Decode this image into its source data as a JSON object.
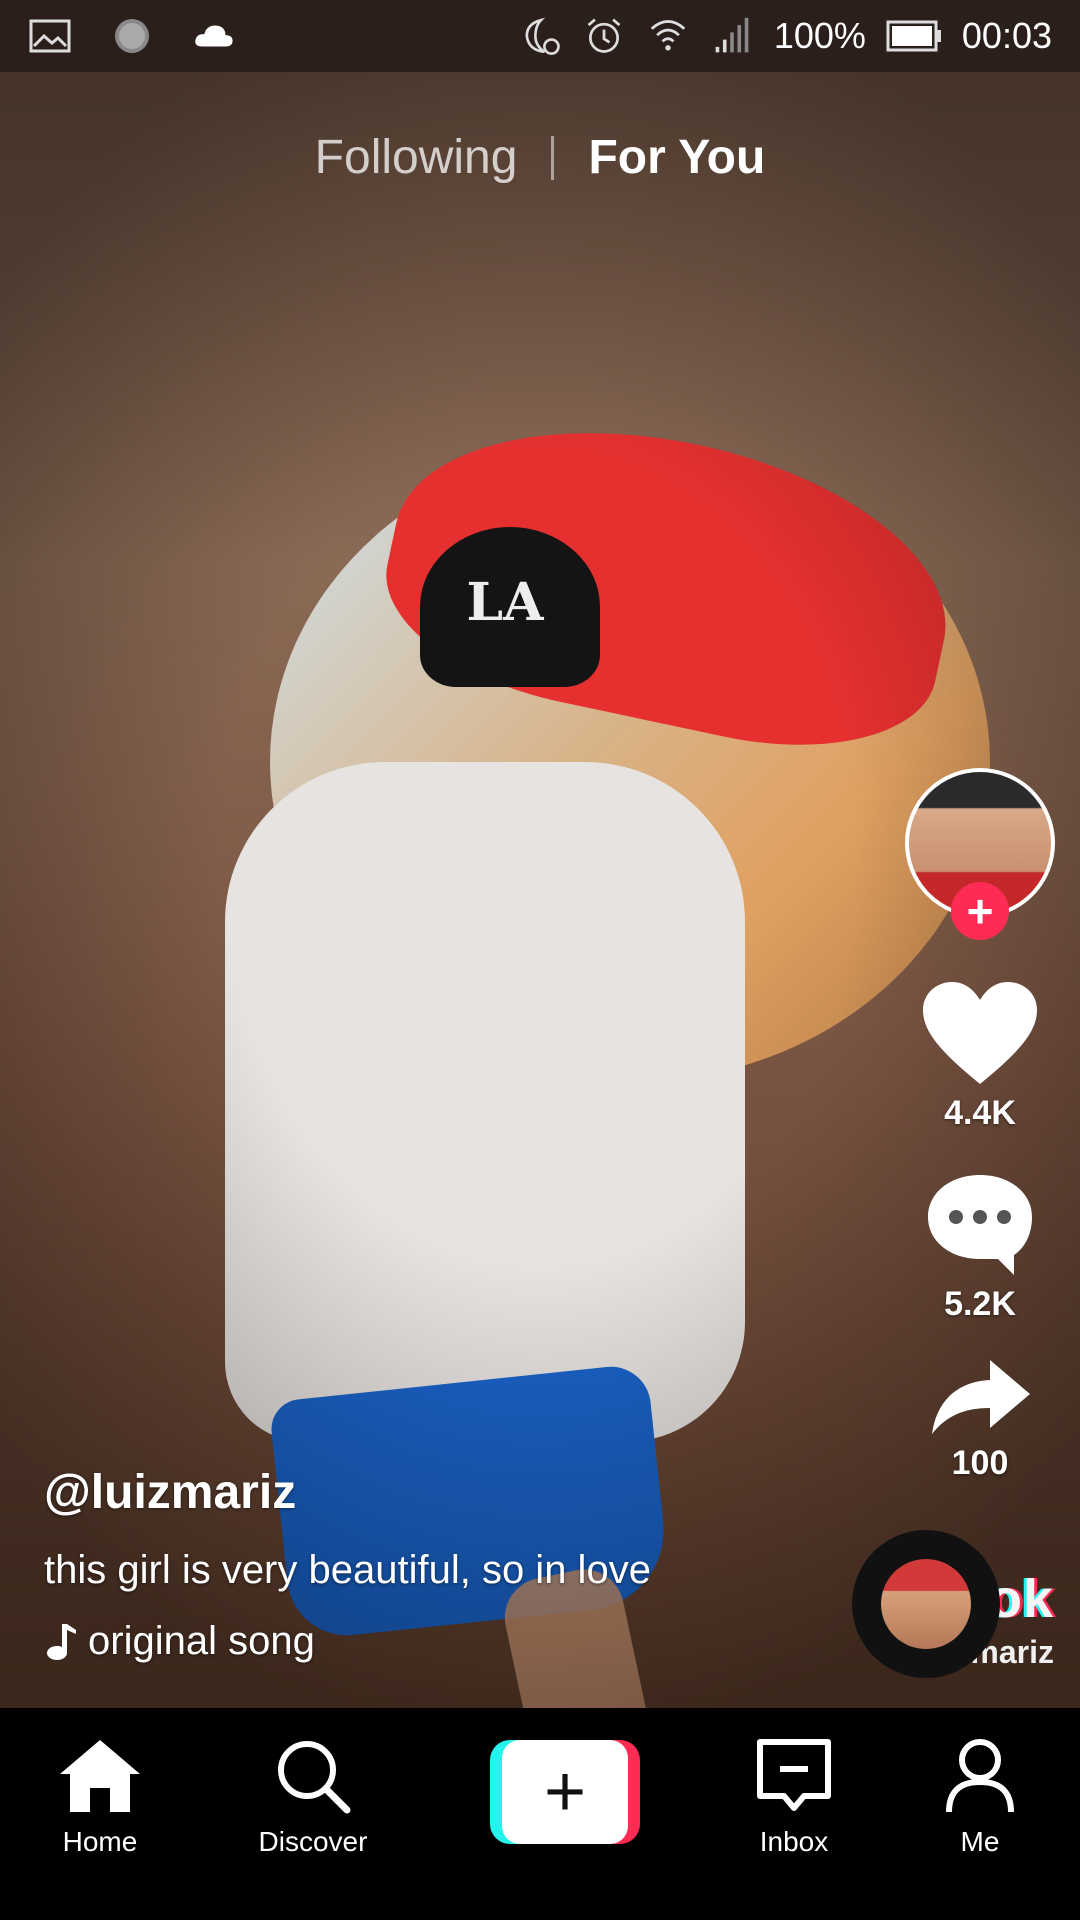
{
  "status_bar": {
    "battery_percent": "100%",
    "time": "00:03",
    "icons": [
      "gallery-icon",
      "loading-icon",
      "cloud-icon",
      "do-not-disturb-icon",
      "alarm-icon",
      "wifi-icon",
      "signal-icon",
      "battery-icon"
    ]
  },
  "top_tabs": {
    "following": "Following",
    "for_you": "For You",
    "active": "For You"
  },
  "rail": {
    "likes": "4.4K",
    "comments": "5.2K",
    "shares": "100",
    "follow_plus": "+"
  },
  "caption": {
    "username": "@luizmariz",
    "description": "this girl is very beautiful, so in love",
    "song": "original song"
  },
  "watermark": {
    "logo": "TikTok",
    "handle": "@luizmariz"
  },
  "video": {
    "hat_text": "LA"
  },
  "bottom_nav": {
    "home": "Home",
    "discover": "Discover",
    "create": "+",
    "inbox": "Inbox",
    "me": "Me",
    "active": "Home"
  },
  "colors": {
    "accent_red": "#fe2c55",
    "accent_cyan": "#25f4ee",
    "nav_bg": "#000000"
  }
}
